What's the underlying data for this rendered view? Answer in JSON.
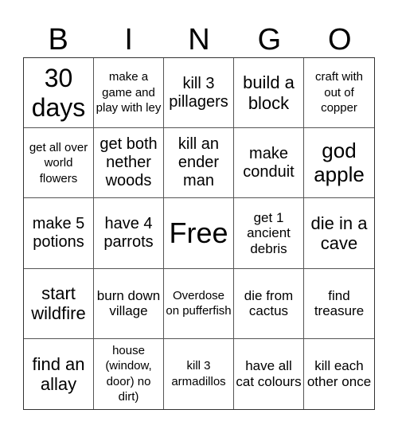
{
  "header": {
    "letters": [
      "B",
      "I",
      "N",
      "G",
      "O"
    ]
  },
  "cells": [
    "30 days",
    "make a game and play with ley",
    "kill 3 pillagers",
    "build a block",
    "craft with out of copper",
    "get all over world flowers",
    "get both nether woods",
    "kill an ender man",
    "make conduit",
    "god apple",
    "make 5 potions",
    "have 4 parrots",
    "Free",
    "get 1 ancient debris",
    "die in a cave",
    "start wildfire",
    "burn down village",
    "Overdose on pufferfish",
    "die from cactus",
    "find treasure",
    "find an allay",
    "house (window, door) no dirt)",
    "kill 3 armadillos",
    "have all cat colours",
    "kill each other once"
  ]
}
